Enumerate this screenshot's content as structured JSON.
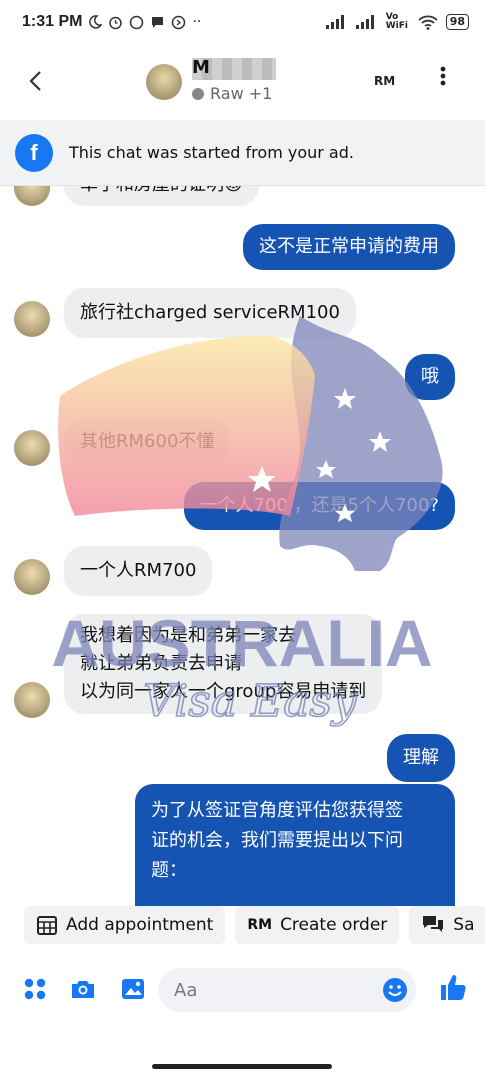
{
  "status_bar": {
    "time": "1:31 PM",
    "icons": [
      "moon-icon",
      "alarm-icon",
      "whatsapp-icon",
      "chat-icon",
      "signal-icon"
    ],
    "network": "Vo WiFi",
    "battery": "98"
  },
  "header": {
    "name": "M",
    "subtitle": "Raw +1",
    "currency_label": "RM"
  },
  "banner": {
    "text": "This chat was started from your ad."
  },
  "messages": [
    {
      "dir": "in",
      "text": "单子和房屋的证明😡"
    },
    {
      "dir": "out",
      "text": "这不是正常申请的费用"
    },
    {
      "dir": "in",
      "text": "旅行社charged serviceRM100"
    },
    {
      "dir": "out",
      "text": "哦"
    },
    {
      "dir": "in",
      "text": "其他RM600不懂"
    },
    {
      "dir": "out",
      "text": "一个人700 ，还是5个人700?"
    },
    {
      "dir": "in",
      "text": "一个人RM700"
    },
    {
      "dir": "in",
      "lines": [
        "我想着因为是和弟弟一家去",
        "就让弟弟负责去申请",
        "以为同一家人一个group容易申请到"
      ]
    },
    {
      "dir": "out",
      "text": "理解"
    },
    {
      "dir": "out",
      "lines": [
        "为了从签证官角度评估您获得签",
        "证的机会，我们需要提出以下问",
        "题："
      ]
    }
  ],
  "watermark": {
    "title": "AUSTRALIA",
    "subtitle": "Visa Easy"
  },
  "chips": [
    {
      "icon": "calendar-icon",
      "label": "Add appointment"
    },
    {
      "icon": "RM",
      "label": "Create order"
    },
    {
      "icon": "chat-bubbles-icon",
      "label": "Sa"
    }
  ],
  "composer": {
    "placeholder": "Aa"
  },
  "colors": {
    "accent": "#1554b3",
    "incoming_bg": "#eceef0",
    "facebook_blue": "#1877f2"
  }
}
